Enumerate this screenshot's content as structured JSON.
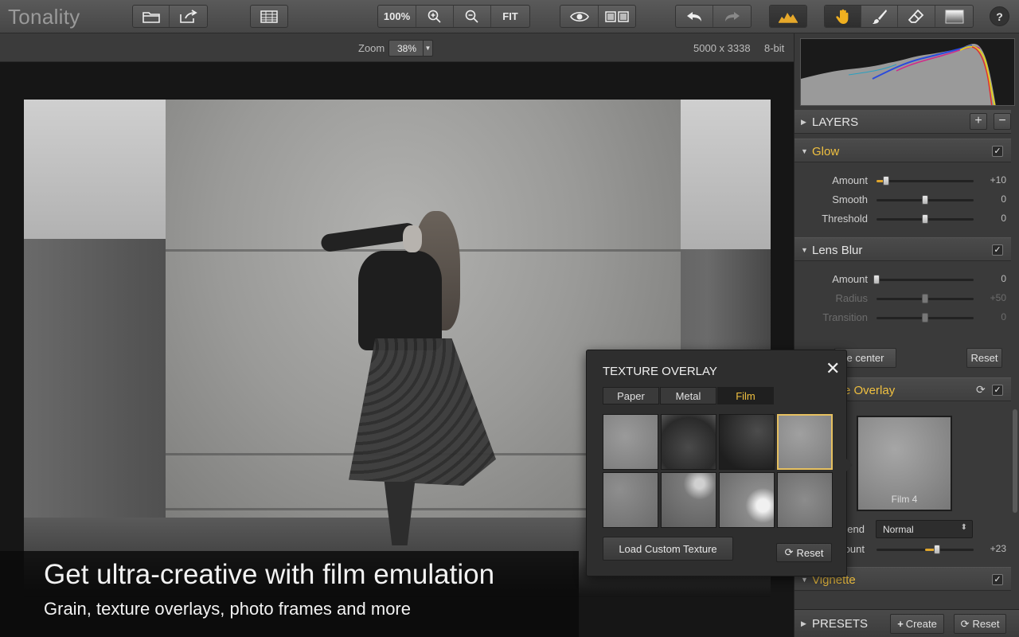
{
  "app": {
    "title": "Tonality"
  },
  "toolbar": {
    "zoom_100": "100%",
    "fit": "FIT",
    "help": "?"
  },
  "statusbar": {
    "zoom_label": "Zoom",
    "zoom_value": "38%",
    "dimensions": "5000 x 3338",
    "bit_depth": "8-bit"
  },
  "promo": {
    "title": "Get ultra-creative with film emulation",
    "subtitle": "Grain, texture overlays, photo frames and more"
  },
  "panel": {
    "layers_label": "LAYERS",
    "sections": {
      "glow": {
        "title": "Glow",
        "params": [
          {
            "label": "Amount",
            "value": "+10",
            "level": 0.1,
            "fill_from": 0.0
          },
          {
            "label": "Smooth",
            "value": "0",
            "level": 0.5
          },
          {
            "label": "Threshold",
            "value": "0",
            "level": 0.5
          }
        ]
      },
      "lens_blur": {
        "title": "Lens Blur",
        "params": [
          {
            "label": "Amount",
            "value": "0",
            "level": 0.0
          },
          {
            "label": "Radius",
            "value": "+50",
            "level": 0.5,
            "disabled": true
          },
          {
            "label": "Transition",
            "value": "0",
            "level": 0.5,
            "disabled": true
          }
        ],
        "center_button": "e center",
        "reset_button": "Reset"
      },
      "texture_overlay": {
        "title": "e Overlay",
        "preview_label": "Film 4",
        "blend_label": "lend",
        "blend_value": "Normal",
        "amount_label": "ount",
        "amount_value": "+23",
        "amount_level": 0.62
      },
      "vignette": {
        "title": "Vignette"
      }
    },
    "presets": {
      "label": "PRESETS",
      "create": "Create",
      "reset": "Reset"
    }
  },
  "popup": {
    "title": "TEXTURE OVERLAY",
    "tabs": [
      "Paper",
      "Metal",
      "Film"
    ],
    "active_tab": "Film",
    "load_button": "Load Custom Texture",
    "reset_button": "Reset"
  },
  "colors": {
    "accent": "#f0c040",
    "slider_fill": "#e0a62c"
  }
}
